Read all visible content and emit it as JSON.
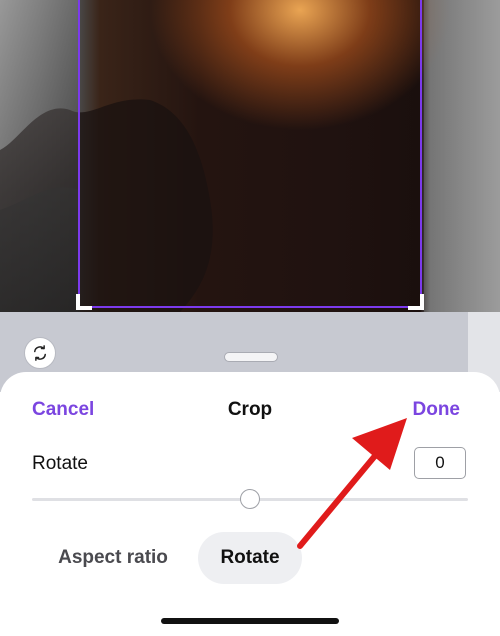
{
  "header": {
    "cancel_label": "Cancel",
    "title": "Crop",
    "done_label": "Done"
  },
  "rotate": {
    "label": "Rotate",
    "value": "0",
    "slider_fraction": 0.5
  },
  "tabs": [
    {
      "label": "Aspect ratio",
      "active": false
    },
    {
      "label": "Rotate",
      "active": true
    }
  ],
  "icons": {
    "reset": "rotate-reset-icon"
  },
  "colors": {
    "accent": "#7b45e0",
    "crop_frame": "#7c3aed",
    "annotation_arrow": "#e01b1b"
  }
}
